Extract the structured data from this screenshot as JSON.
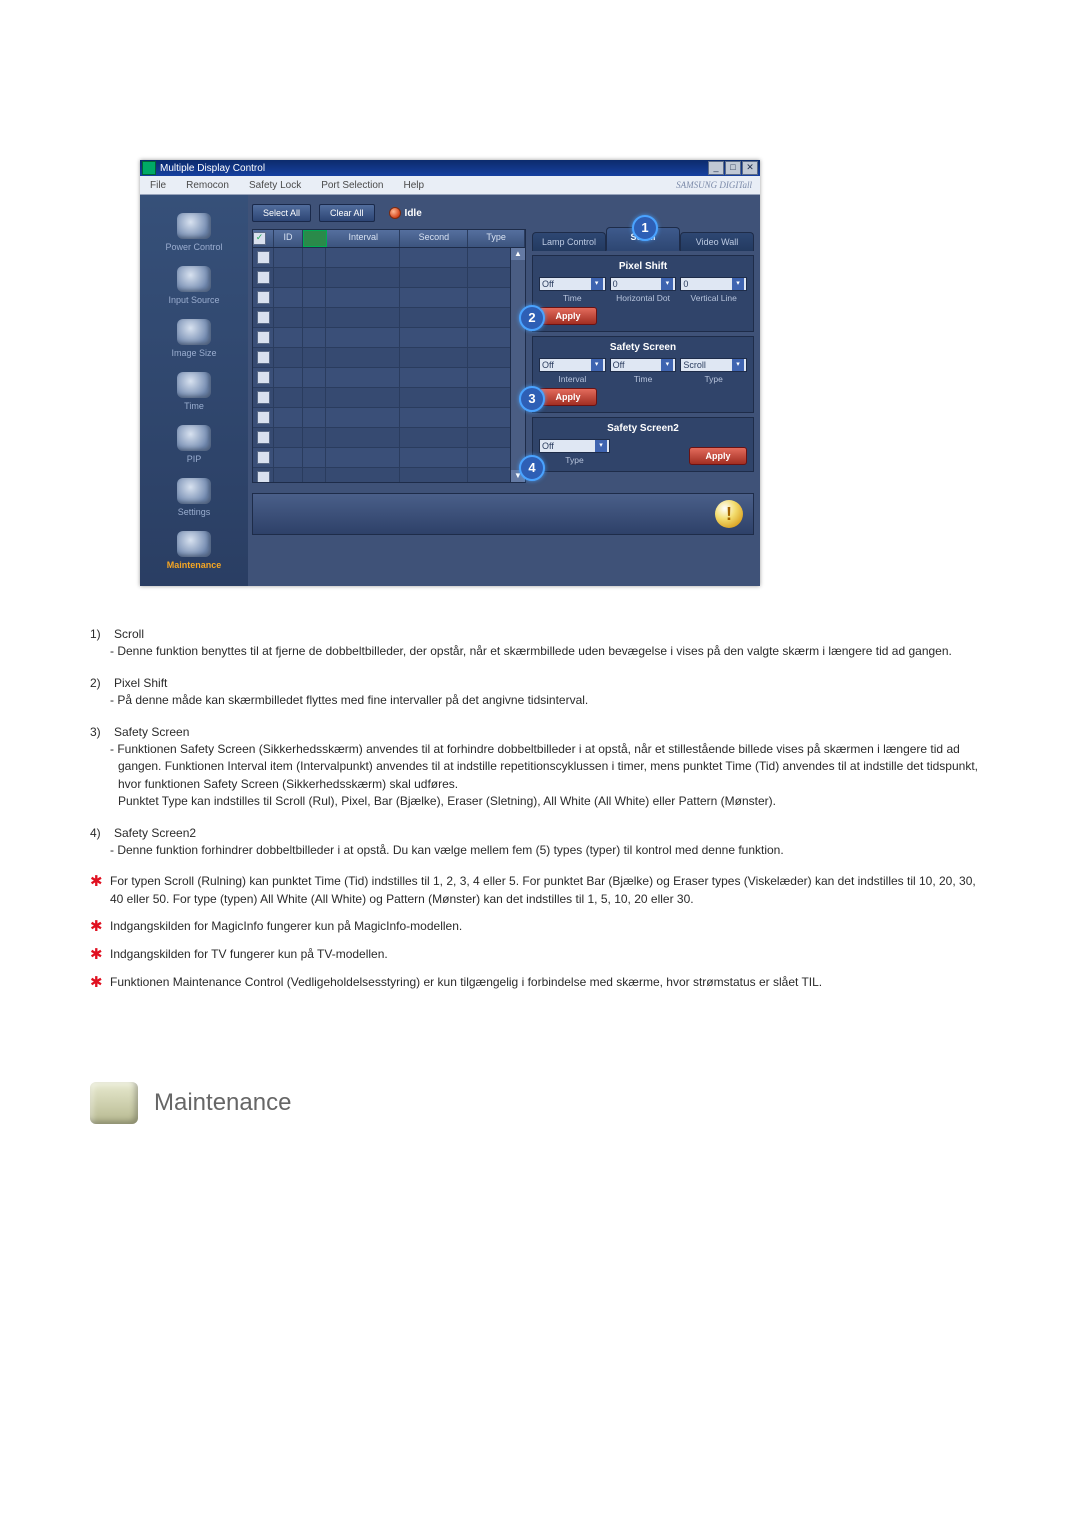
{
  "app": {
    "title": "Multiple Display Control",
    "brand": "SAMSUNG DIGITall"
  },
  "menu": {
    "file": "File",
    "remocon": "Remocon",
    "safety_lock": "Safety Lock",
    "port_selection": "Port Selection",
    "help": "Help"
  },
  "sidebar": {
    "items": [
      {
        "label": "Power Control"
      },
      {
        "label": "Input Source"
      },
      {
        "label": "Image Size"
      },
      {
        "label": "Time"
      },
      {
        "label": "PIP"
      },
      {
        "label": "Settings"
      },
      {
        "label": "Maintenance"
      }
    ]
  },
  "toolbar": {
    "select_all": "Select All",
    "clear_all": "Clear All",
    "idle_label": "Idle"
  },
  "grid": {
    "headers": {
      "chk": "",
      "id": "ID",
      "lamp": "",
      "interval": "Interval",
      "second": "Second",
      "type": "Type"
    }
  },
  "tabs": {
    "lamp_control": "Lamp Control",
    "scroll": "Scroll",
    "video_wall": "Video Wall"
  },
  "callouts": {
    "c1": "1",
    "c2": "2",
    "c3": "3",
    "c4": "4"
  },
  "panels": {
    "pixel_shift": {
      "title": "Pixel Shift",
      "time_value": "Off",
      "hdot_value": "0",
      "vline_value": "0",
      "time_label": "Time",
      "hdot_label": "Horizontal Dot",
      "vline_label": "Vertical Line",
      "apply": "Apply"
    },
    "safety_screen": {
      "title": "Safety Screen",
      "interval_value": "Off",
      "time_value": "Off",
      "type_value": "Scroll",
      "interval_label": "Interval",
      "time_label": "Time",
      "type_label": "Type",
      "apply": "Apply"
    },
    "safety_screen2": {
      "title": "Safety Screen2",
      "type_value": "Off",
      "type_label": "Type",
      "apply": "Apply"
    }
  },
  "footer": {
    "warning_glyph": "!"
  },
  "doc": {
    "items": [
      {
        "idx": "1)",
        "title": "Scroll",
        "body": "Denne funktion benyttes til at fjerne de dobbeltbilleder, der opstår, når et skærmbillede uden bevægelse i vises på den valgte skærm i længere tid ad gangen."
      },
      {
        "idx": "2)",
        "title": "Pixel Shift",
        "body": "På denne måde kan skærmbilledet flyttes med fine intervaller på det angivne tidsinterval."
      },
      {
        "idx": "3)",
        "title": "Safety Screen",
        "body": "Funktionen Safety Screen (Sikkerhedsskærm) anvendes til at forhindre dobbeltbilleder i at opstå, når et stillestående billede vises på skærmen i længere tid ad gangen.  Funktionen Interval item (Intervalpunkt) anvendes til at indstille repetitionscyklussen i timer, mens punktet Time (Tid) anvendes til at indstille det tidspunkt, hvor funktionen Safety Screen (Sikkerhedsskærm) skal udføres.\nPunktet Type kan indstilles til Scroll (Rul), Pixel, Bar (Bjælke), Eraser (Sletning), All White (All White) eller Pattern (Mønster)."
      },
      {
        "idx": "4)",
        "title": "Safety Screen2",
        "body": "Denne funktion forhindrer dobbeltbilleder i at opstå. Du kan vælge mellem fem (5) types (typer) til kontrol med denne funktion."
      }
    ],
    "star_items": [
      "For typen Scroll (Rulning) kan punktet Time (Tid) indstilles til 1, 2, 3, 4 eller 5. For punktet Bar (Bjælke) og Eraser types (Viskelæder) kan det indstilles til 10, 20, 30, 40 eller 50. For type (typen) All White (All White) og Pattern (Mønster) kan det indstilles til 1, 5, 10, 20 eller 30.",
      "Indgangskilden for MagicInfo fungerer kun på MagicInfo-modellen.",
      "Indgangskilden for TV fungerer kun på TV-modellen.",
      "Funktionen Maintenance Control (Vedligeholdelsesstyring) er kun tilgængelig i forbindelse med skærme, hvor strømstatus er slået TIL."
    ],
    "section_heading": "Maintenance"
  }
}
